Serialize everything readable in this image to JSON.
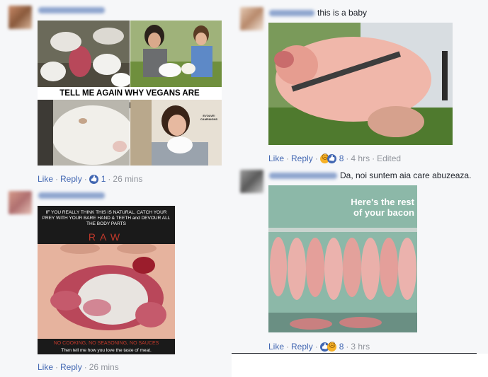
{
  "comments": [
    {
      "id": "c1",
      "image_caption": "TELL ME AGAIN WHY VEGANS ARE EXTREME?",
      "image_small_text": "EVOLVE! CAMPAIGNS",
      "like": "Like",
      "reply": "Reply",
      "reaction_count": "1",
      "time": "26 mins"
    },
    {
      "id": "c2",
      "image_text_top": "IF YOU REALLY THINK THIS IS NATURAL, CATCH YOUR PREY WITH YOUR BARE HAND & TEETH and DEVOUR ALL THE BODY PARTS",
      "image_text_raw": "RAW",
      "image_text_bottom": "NO COOKING, NO SEASONING, NO SAUCES",
      "image_text_bottom2": "Then tell me how you love the taste of meat.",
      "like": "Like",
      "reply": "Reply",
      "time": "26 mins"
    },
    {
      "id": "c3",
      "text": "this is a baby",
      "like": "Like",
      "reply": "Reply",
      "reaction_count": "8",
      "time": "4 hrs",
      "edited": "Edited"
    },
    {
      "id": "c4",
      "text": "Da, noi suntem aia care abuzeaza.",
      "image_text": "Here's the rest of your bacon",
      "like": "Like",
      "reply": "Reply",
      "reaction_count": "8",
      "time": "3 hrs"
    }
  ],
  "colors": {
    "link": "#4267b2",
    "meta": "#90949c",
    "background": "#f6f7f9"
  }
}
